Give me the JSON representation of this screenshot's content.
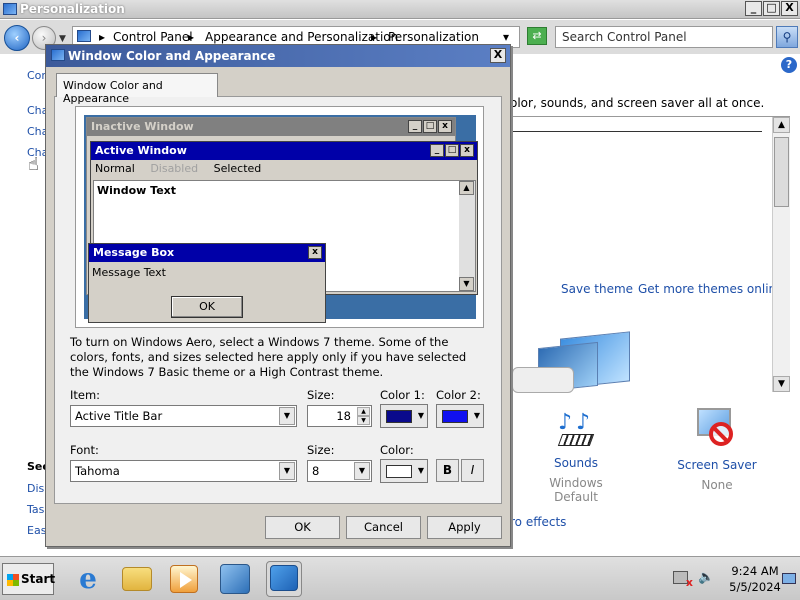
{
  "window": {
    "title": "Personalization",
    "buttons": {
      "minimize": "_",
      "maximize": "□",
      "close": "X"
    }
  },
  "address_bar": {
    "crumbs": [
      "Control Panel",
      "Appearance and Personalization",
      "Personalization"
    ],
    "search_placeholder": "Search Control Panel"
  },
  "sidebar": {
    "top_links": [
      "Cor",
      "Cha",
      "Cha",
      "Cha"
    ],
    "see_also_head": "Sec",
    "bottom_links": [
      "Disp",
      "Tas",
      "Eas"
    ]
  },
  "main": {
    "description": "olor, sounds, and screen saver all at once.",
    "save_theme": "Save theme",
    "get_more_themes": "Get more themes online",
    "sounds": {
      "label": "Sounds",
      "value": "Windows Default"
    },
    "screen_saver": {
      "label": "Screen Saver",
      "value": "None"
    },
    "ease_link": "ro effects"
  },
  "dialog": {
    "title": "Window Color and Appearance",
    "tab_label": "Window Color and Appearance",
    "preview": {
      "inactive_title": "Inactive Window",
      "active_title": "Active Window",
      "menu": [
        "Normal",
        "Disabled",
        "Selected"
      ],
      "window_text": "Window Text",
      "msgbox_title": "Message Box",
      "msgbox_text": "Message Text",
      "msgbox_ok": "OK"
    },
    "info": "To turn on Windows Aero, select a Windows 7 theme.  Some of the colors, fonts, and sizes selected here apply only if you have selected the Windows 7 Basic theme or a High Contrast theme.",
    "item_label": "Item:",
    "item_value": "Active Title Bar",
    "size1_label": "Size:",
    "size1_value": "18",
    "color1_label": "Color 1:",
    "color1": "#0a0a8c",
    "color2_label": "Color 2:",
    "color2": "#1010f0",
    "font_label": "Font:",
    "font_value": "Tahoma",
    "size2_label": "Size:",
    "size2_value": "8",
    "font_color_label": "Color:",
    "font_color": "#ffffff",
    "bold": "B",
    "italic": "I",
    "ok": "OK",
    "cancel": "Cancel",
    "apply": "Apply"
  },
  "taskbar": {
    "start": "Start",
    "time": "9:24 AM",
    "date": "5/5/2024"
  }
}
